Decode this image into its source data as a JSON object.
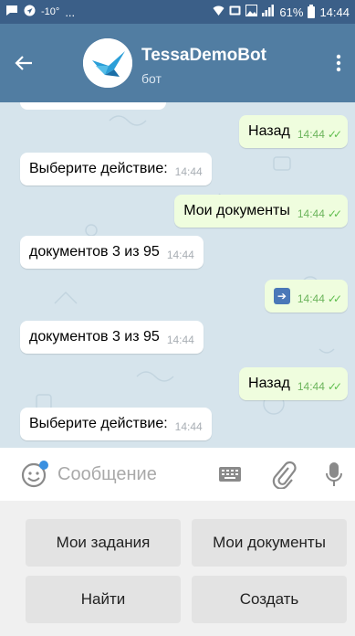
{
  "status_bar": {
    "temp": "-10°",
    "ellipsis": "...",
    "battery": "61%",
    "time": "14:44"
  },
  "header": {
    "title": "TessaDemoBot",
    "subtitle": "бот"
  },
  "messages": [
    {
      "dir": "out",
      "text": "Назад",
      "time": "14:44",
      "read": true
    },
    {
      "dir": "in",
      "text": "Выберите действие:",
      "time": "14:44"
    },
    {
      "dir": "out",
      "text": "Мои документы",
      "time": "14:44",
      "read": true
    },
    {
      "dir": "in",
      "text": "документов 3 из 95",
      "time": "14:44"
    },
    {
      "dir": "out",
      "emoji": "right-arrow-emoji",
      "time": "14:44",
      "read": true
    },
    {
      "dir": "in",
      "text": "документов 3 из 95",
      "time": "14:44"
    },
    {
      "dir": "out",
      "text": "Назад",
      "time": "14:44",
      "read": true
    },
    {
      "dir": "in",
      "text": "Выберите действие:",
      "time": "14:44"
    }
  ],
  "input": {
    "placeholder": "Сообщение"
  },
  "keyboard": {
    "buttons": [
      "Мои задания",
      "Мои документы",
      "Найти",
      "Создать"
    ]
  },
  "colors": {
    "header": "#517da2",
    "status_bar": "#3b5f88",
    "chat_bg": "#d6e4ec",
    "out_bubble": "#effdde",
    "in_bubble": "#ffffff",
    "check": "#5fbe4e"
  }
}
